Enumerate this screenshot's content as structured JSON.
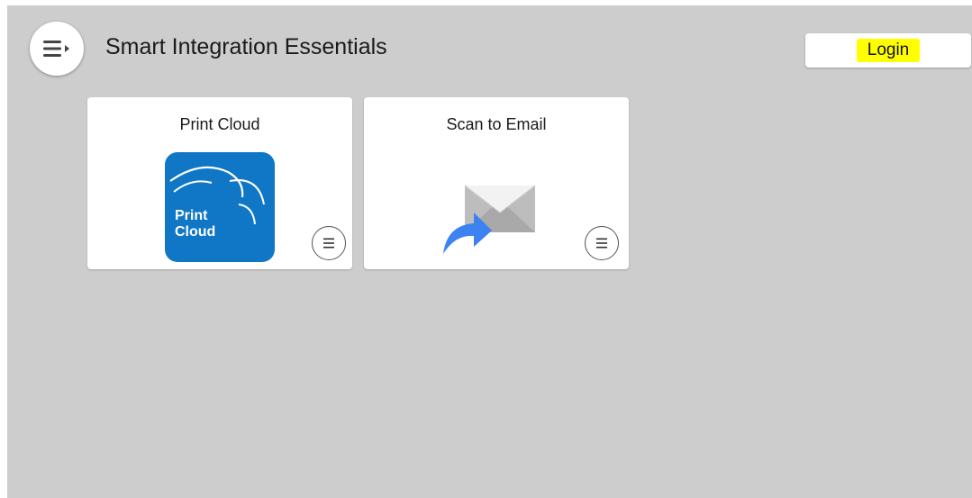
{
  "header": {
    "title": "Smart Integration Essentials",
    "login_label": "Login",
    "menu_icon": "hamburger-menu-icon"
  },
  "tiles": [
    {
      "title": "Print Cloud",
      "logo_text_line1": "Print",
      "logo_text_line2": "Cloud",
      "icon": "print-cloud-logo-icon",
      "menu_icon": "list-menu-icon"
    },
    {
      "title": "Scan to Email",
      "icon": "envelope-arrow-icon",
      "menu_icon": "list-menu-icon"
    }
  ],
  "colors": {
    "background": "#cdcdcd",
    "tile": "#ffffff",
    "print_cloud_blue": "#0f77c5",
    "arrow_blue": "#3c82f0",
    "login_highlight": "#ffff00"
  }
}
